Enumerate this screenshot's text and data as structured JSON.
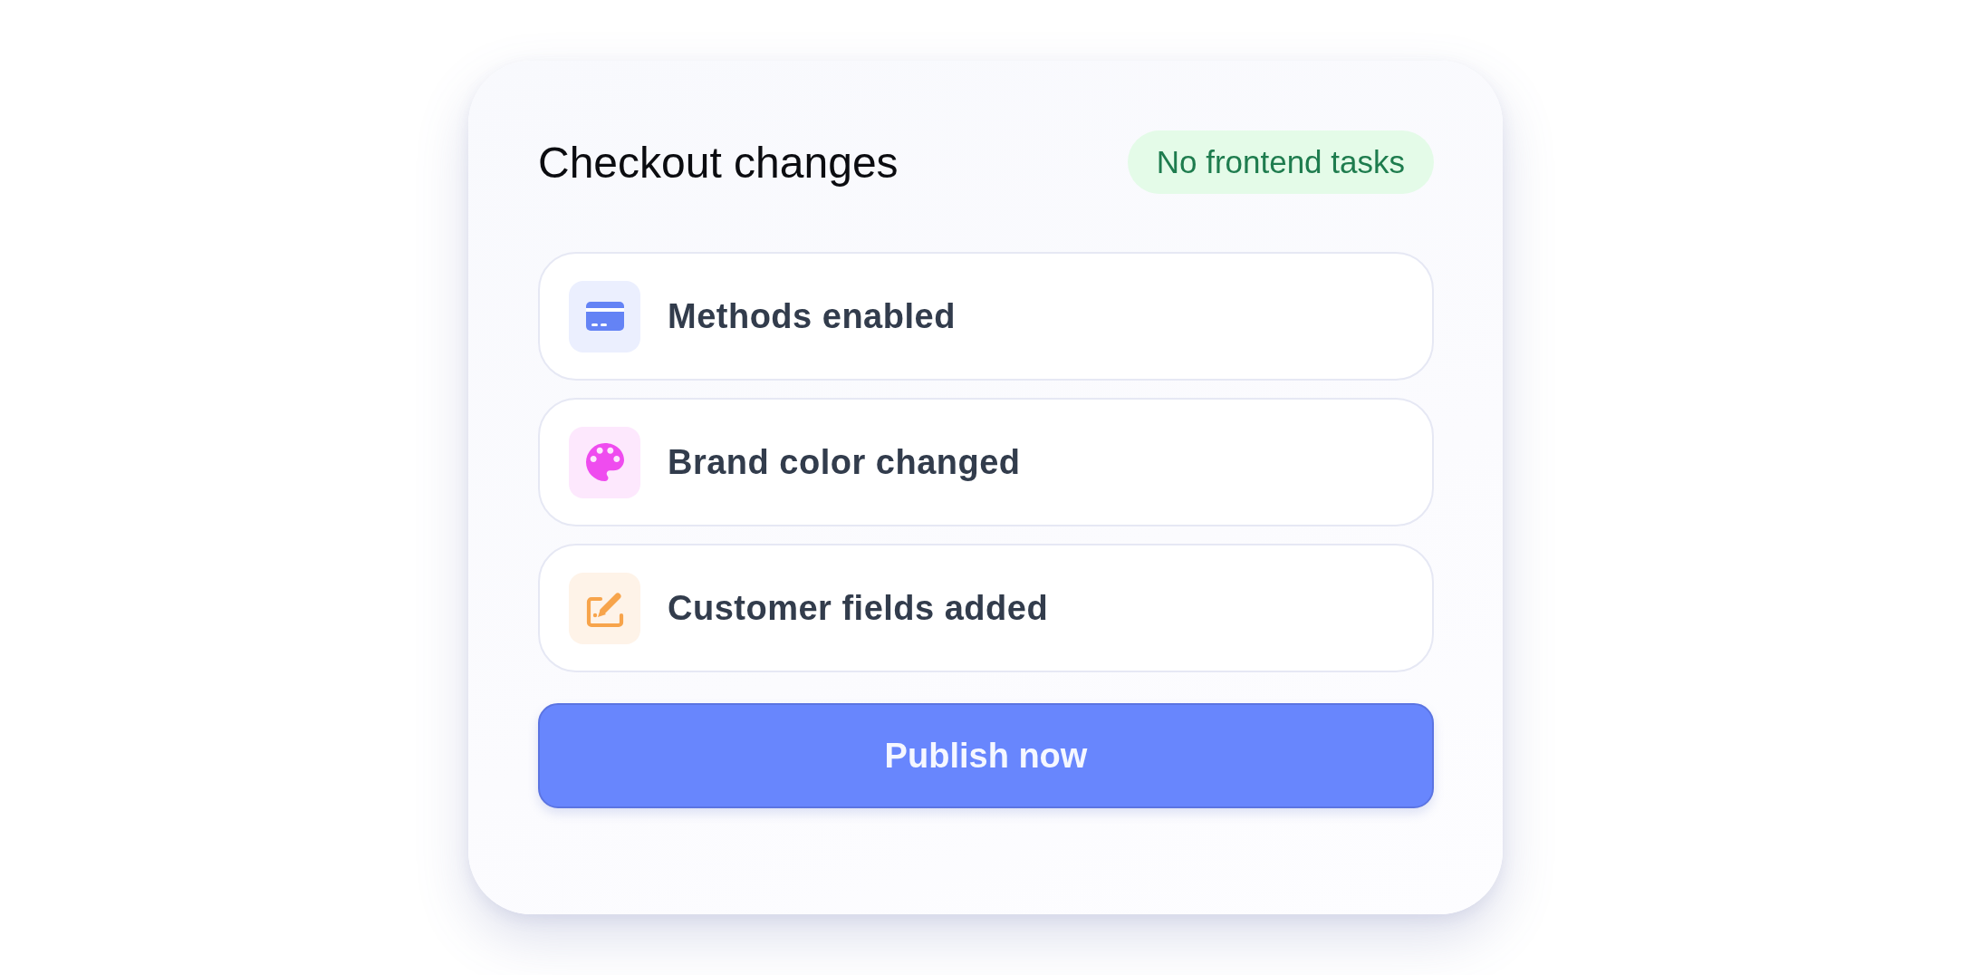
{
  "card": {
    "title": "Checkout changes",
    "badge": "No frontend tasks"
  },
  "changes": [
    {
      "label": "Methods enabled",
      "color": "#6483f5"
    },
    {
      "label": "Brand color changed",
      "color": "#ef4cef"
    },
    {
      "label": "Customer fields added",
      "color": "#f7a44b"
    }
  ],
  "primary_button": {
    "label": "Publish now"
  }
}
